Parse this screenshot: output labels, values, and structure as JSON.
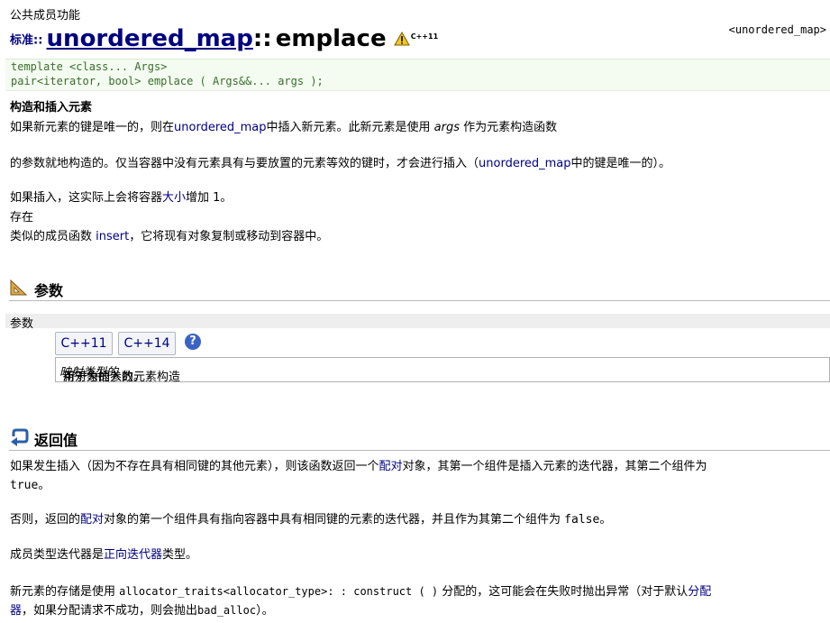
{
  "header": {
    "section_label": "公共成员功能",
    "namespace": "标准::",
    "class_link": "unordered_map",
    "separator": "::",
    "function_name": "emplace",
    "badge_text": "C++11",
    "ref": "<unordered_map>"
  },
  "prototype": {
    "line1": "template <class... Args>",
    "line2": "pair<iterator, bool> emplace ( Args&&... args );"
  },
  "description": {
    "heading": "构造和插入元素",
    "p1_a": "如果新元素的键是唯一的，则在",
    "p1_link": "unordered_map",
    "p1_b": "中插入新元素。此新元素是使用 ",
    "p1_args": "args",
    "p1_c": " 作为元素构造函数",
    "p2_a": "的参数就地构造的。仅当容器中没有元素具有与要放置的元素等效的键时，才会进行插入（",
    "p2_link": "unordered_map",
    "p2_b": "中的键是唯一的）。",
    "p3_a": "如果插入，这实际上会将容器",
    "p3_link": "大小",
    "p3_b": "增加 1。",
    "p4": "存在",
    "p5_a": "类似的成员函数 ",
    "p5_link": "insert",
    "p5_b": "，它将现有对象复制或移动到容器中。"
  },
  "parameters": {
    "section_title": "参数",
    "bar_label": "参数",
    "tab1": "C++11",
    "tab2": "C++14",
    "help": "?",
    "desc_a": "用于为插入的元素构造",
    "desc_em": "映射类型的",
    "desc_b": "新对象的参数。"
  },
  "return": {
    "section_title": "返回值",
    "r1_a": "如果发生插入（因为不存在具有相同键的其他元素），则该函数返回一个",
    "r1_link": "配对",
    "r1_b": "对象，其第一个组件是插入元素的迭代器，其第二个组件为",
    "r1_code": "true",
    "r1_c": "。",
    "r2_a": "否则，返回的",
    "r2_link": "配对",
    "r2_b": "对象的第一个组件具有指向容器中具有相同键的元素的迭代器，并且作为其第二个组件为 ",
    "r2_code": "false",
    "r2_c": "。",
    "r3_a": "成员类型迭代器是",
    "r3_link": "正向迭代器",
    "r3_b": "类型。",
    "r4_a": "新元素的存储是使用 ",
    "r4_code": "allocator_traits<allocator_type>: : construct ( )",
    "r4_b": " 分配的，这可能会在失败时抛出异常（对于默认",
    "r4_link1": "分配",
    "r4_link2": "器",
    "r4_c": "，如果分配请求不成功，则会抛出",
    "r4_code2": "bad_alloc",
    "r4_d": "）。"
  },
  "colors": {
    "link": "#000080",
    "proto_bg": "#f4fbf1",
    "proto_text": "#3a6e2b",
    "help_bg": "#3a63c3"
  }
}
